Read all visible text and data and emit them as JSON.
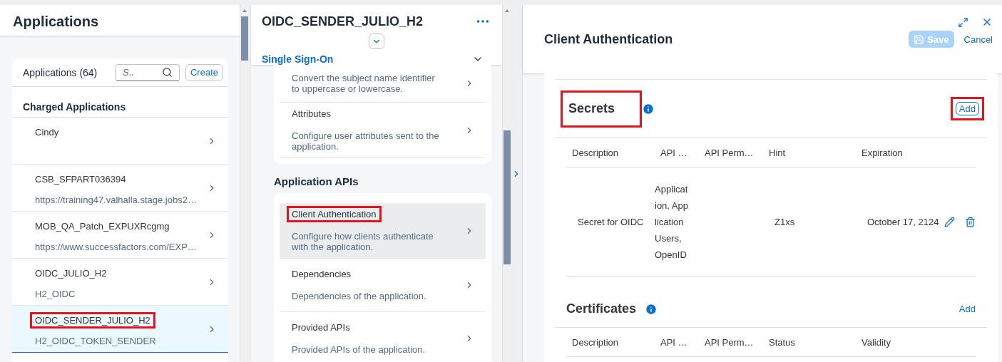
{
  "left_panel": {
    "title": "Applications",
    "list_title": "Applications (64)",
    "search": {
      "placeholder": "S.."
    },
    "create_button": "Create",
    "group_title": "Charged Applications",
    "items": [
      {
        "name": "Cindy",
        "selected": false,
        "highlighted": false
      },
      {
        "name": "CSB_SFPART036394",
        "subtitle": "https://training47.valhalla.stage.jobs2…",
        "selected": false,
        "highlighted": false
      },
      {
        "name": "MOB_QA_Patch_EXPUXRcgmg",
        "subtitle": "https://www.successfactors.com/EXP…",
        "selected": false,
        "highlighted": false
      },
      {
        "name": "OIDC_JULIO_H2",
        "subtitle": "H2_OIDC",
        "selected": false,
        "highlighted": false
      },
      {
        "name": "OIDC_SENDER_JULIO_H2",
        "subtitle": "H2_OIDC_TOKEN_SENDER",
        "selected": true,
        "highlighted": true
      }
    ]
  },
  "middle_panel": {
    "title": "OIDC_SENDER_JULIO_H2",
    "section_tab": "Single Sign-On",
    "sso_items": [
      {
        "description": "Convert the subject name identifier to uppercase or lowercase."
      },
      {
        "title": "Attributes",
        "description": "Configure user attributes sent to the application."
      }
    ],
    "api_section_title": "Application APIs",
    "api_items": [
      {
        "title": "Client Authentication",
        "description": "Configure how clients authenticate with the application.",
        "selected": true,
        "highlighted": true
      },
      {
        "title": "Dependencies",
        "description": "Dependencies of the application.",
        "selected": false,
        "highlighted": false
      },
      {
        "title": "Provided APIs",
        "description": "Provided APIs of the application.",
        "selected": false,
        "highlighted": false
      }
    ]
  },
  "detail_panel": {
    "title": "Client Authentication",
    "save_button": {
      "label": "Save",
      "disabled": true
    },
    "cancel_button": "Cancel",
    "sections": [
      {
        "title": "Secrets",
        "highlighted": true,
        "add_button": {
          "label": "Add",
          "focused": true,
          "highlighted": true
        },
        "columns": [
          "Description",
          "API …",
          "API Perm…",
          "Hint",
          "Expiration"
        ],
        "rows": [
          {
            "column_1": "Secret for OIDC",
            "column_2": "Application, Application Users, OpenID",
            "column_4": "Z1xs",
            "column_5": "October 17, 2124"
          }
        ]
      },
      {
        "title": "Certificates",
        "highlighted": false,
        "add_button": {
          "label": "Add",
          "focused": false,
          "highlighted": false
        },
        "columns": [
          "Description",
          "API …",
          "API Perm…",
          "Status",
          "Validity"
        ]
      }
    ]
  }
}
